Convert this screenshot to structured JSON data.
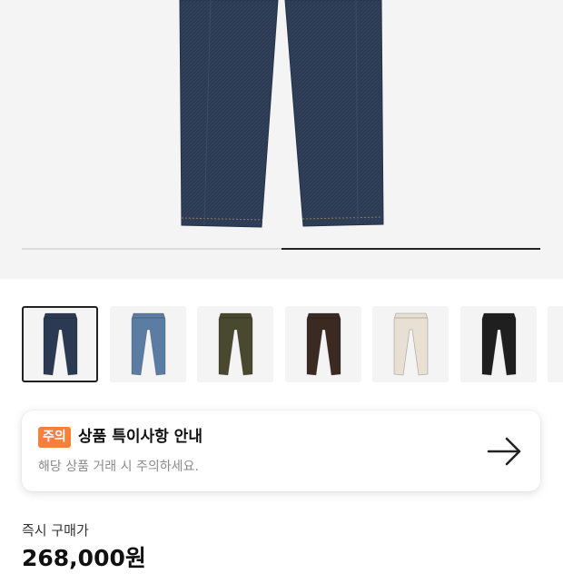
{
  "carousel": {
    "progress": 0.5
  },
  "thumbnails": [
    {
      "color": "#2b3a52",
      "selected": true
    },
    {
      "color": "#5b7da4",
      "selected": false
    },
    {
      "color": "#49492f",
      "selected": false
    },
    {
      "color": "#3a2a22",
      "selected": false
    },
    {
      "color": "#e8e0d2",
      "selected": false
    },
    {
      "color": "#1f1f1f",
      "selected": false
    },
    {
      "color": "#cccccc",
      "selected": false
    }
  ],
  "notice": {
    "badge": "주의",
    "title": "상품 특이사항 안내",
    "description": "해당 상품 거래 시 주의하세요.",
    "icon": "arrow-right-icon"
  },
  "price": {
    "label": "즉시 구매가",
    "value": "268,000원"
  },
  "colors": {
    "badge": "#f6803b",
    "hero_bg": "#f4f4f4",
    "denim": "#2b3a52"
  }
}
